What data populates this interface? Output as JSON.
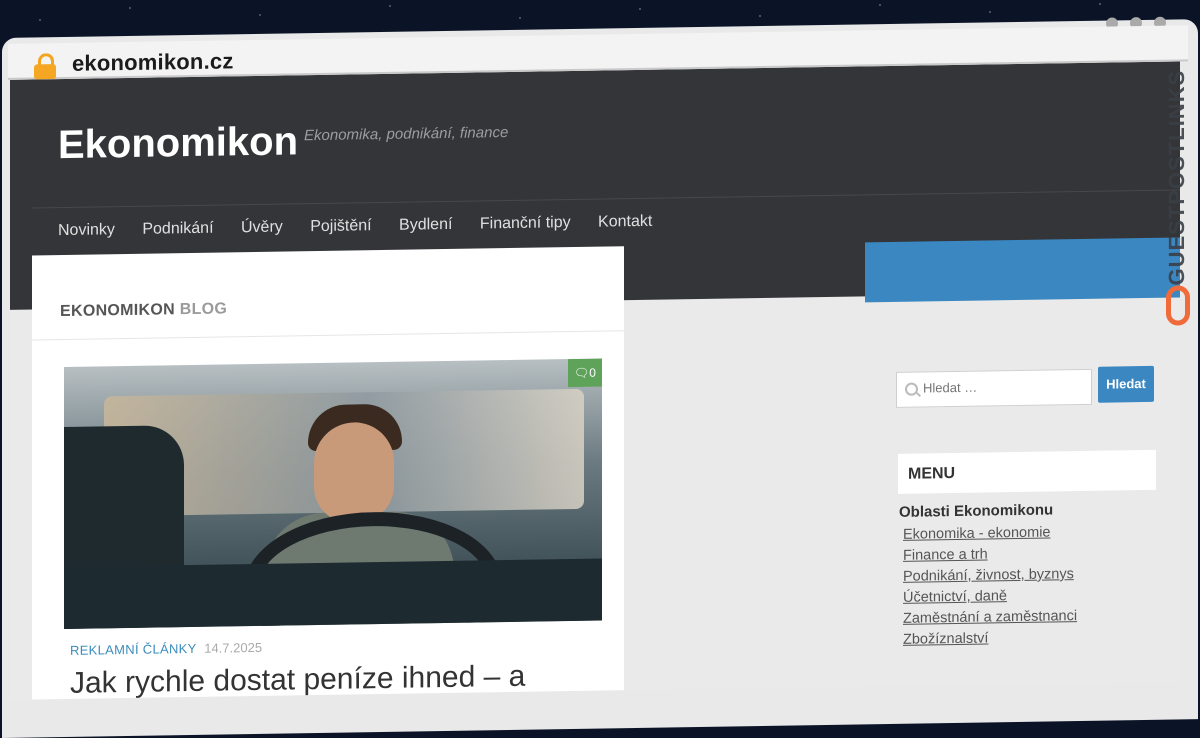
{
  "browser": {
    "url": "ekonomikon.cz"
  },
  "site": {
    "name": "Ekonomikon",
    "tagline": "Ekonomika, podnikání, finance",
    "nav": [
      "Novinky",
      "Podnikání",
      "Úvěry",
      "Pojištění",
      "Bydlení",
      "Finanční tipy",
      "Kontakt"
    ]
  },
  "blog": {
    "title_strong": "EKONOMIKON",
    "title_light": "BLOG",
    "post": {
      "comments": "0",
      "category": "REKLAMNÍ ČLÁNKY",
      "date": "14.7.2025",
      "title": "Jak rychle dostat peníze ihned – a"
    }
  },
  "sidebar": {
    "search_placeholder": "Hledat …",
    "search_button": "Hledat",
    "menu_title": "MENU",
    "menu_group": "Oblasti Ekonomikonu",
    "menu_items": [
      "Ekonomika - ekonomie",
      "Finance a trh",
      "Podnikání, živnost, byznys",
      "Účetnictví, daně",
      "Zaměstnání a zaměstnanci",
      "Zbožíznalství"
    ]
  },
  "watermark": {
    "text": "GUESTPOSTLINKS"
  },
  "colors": {
    "accent": "#3a87c2",
    "header_bg": "#333538",
    "comments_badge": "#5fa35a"
  }
}
